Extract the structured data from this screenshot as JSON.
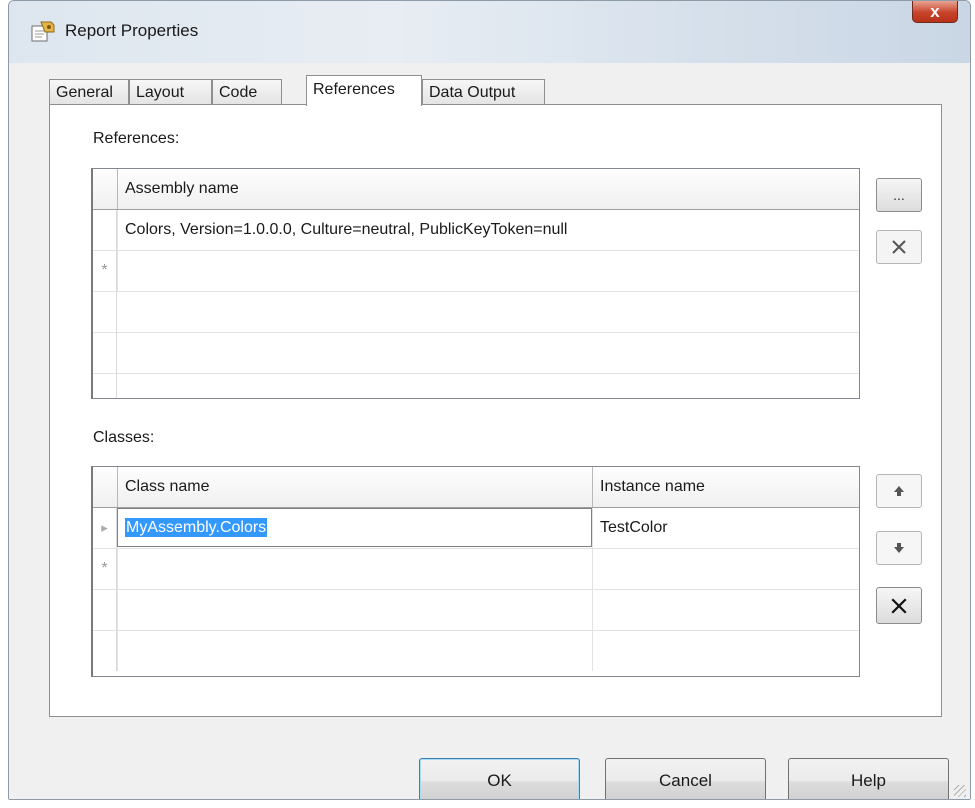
{
  "window": {
    "title": "Report Properties",
    "close_label": "x"
  },
  "tabs": [
    "General",
    "Layout",
    "Code",
    "References",
    "Data Output"
  ],
  "active_tab": "References",
  "references": {
    "label": "References:",
    "column": "Assembly name",
    "rows": [
      "Colors, Version=1.0.0.0, Culture=neutral, PublicKeyToken=null"
    ],
    "new_row_marker": "*",
    "browse_label": "...",
    "delete_icon": "x-icon"
  },
  "classes": {
    "label": "Classes:",
    "columns": [
      "Class name",
      "Instance name"
    ],
    "rows": [
      {
        "class_name": "MyAssembly.Colors",
        "instance_name": "TestColor"
      }
    ],
    "current_row_marker": "▸",
    "new_row_marker": "*",
    "move_up_icon": "arrow-up-icon",
    "move_down_icon": "arrow-down-icon",
    "delete_icon": "x-icon"
  },
  "buttons": {
    "ok": "OK",
    "cancel": "Cancel",
    "help": "Help"
  },
  "colors": {
    "selection": "#3399ff",
    "close_button": "#c7432a"
  }
}
